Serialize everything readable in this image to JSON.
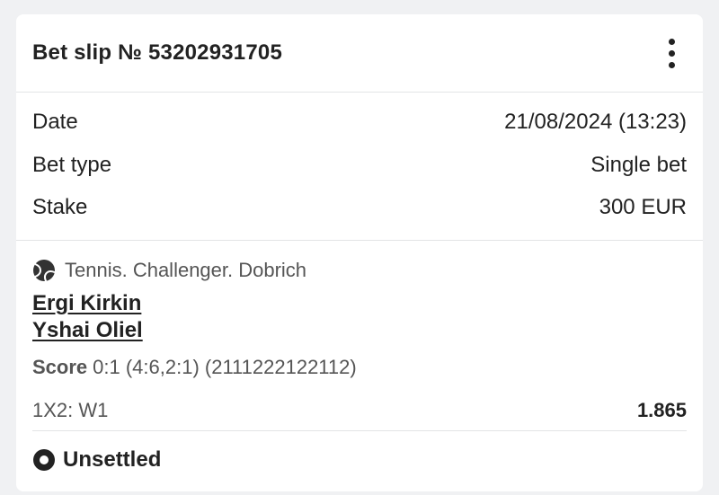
{
  "header": {
    "title": "Bet slip № 53202931705",
    "menu_icon": "more-vertical-icon"
  },
  "details": {
    "date": {
      "label": "Date",
      "value": "21/08/2024 (13:23)"
    },
    "bet_type": {
      "label": "Bet type",
      "value": "Single bet"
    },
    "stake": {
      "label": "Stake",
      "value": "300 EUR"
    }
  },
  "event": {
    "sport_icon": "tennis-ball-icon",
    "sport_text": "Tennis. Challenger. Dobrich",
    "team1": "Ergi Kirkin",
    "team2": "Yshai Oliel",
    "score_label": "Score",
    "score_value": "0:1 (4:6,2:1) (2111222122112)",
    "market": "1X2: W1",
    "odds": "1.865"
  },
  "status": {
    "icon": "record-circle-icon",
    "text": "Unsettled"
  }
}
